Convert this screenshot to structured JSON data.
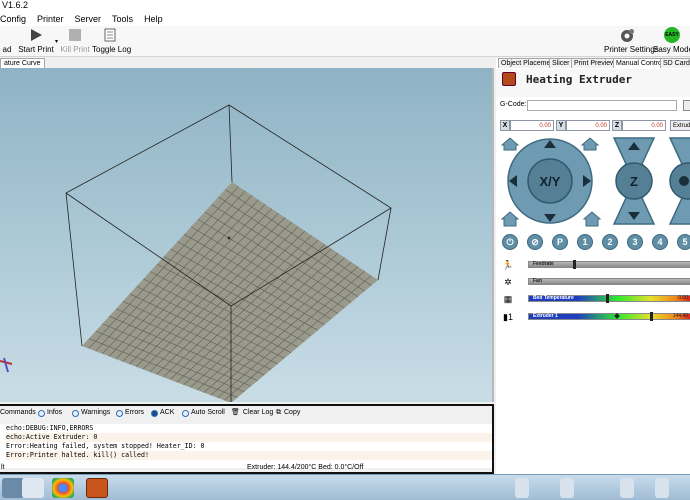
{
  "window": {
    "title": "V1.6.2"
  },
  "menu": [
    "Config",
    "Printer",
    "Server",
    "Tools",
    "Help"
  ],
  "toolbar": {
    "load_label": "ad",
    "start_print_label": "Start Print",
    "kill_print_label": "Kill Print",
    "toggle_log_label": "Toggle Log",
    "printer_settings_label": "Printer Settings",
    "easy_mode_label": "Easy Mode",
    "easy_badge": "EASY"
  },
  "view_tabs": [
    "ature Curve"
  ],
  "right_tabs": [
    "Object Placement",
    "Slicer",
    "Print Preview",
    "Manual Control",
    "SD Card"
  ],
  "right_active_tab": "Manual Control",
  "manual_control": {
    "heading": "Heating Extruder",
    "gcode_label": "G-Code:",
    "gcode_value": "",
    "x_label": "X",
    "x_value": "0.00",
    "y_label": "Y",
    "y_value": "0.00",
    "z_label": "Z",
    "z_value": "0.00",
    "extruder_button": "Extrude",
    "xy_label": "X/Y",
    "z_pad_label": "Z",
    "number_buttons": [
      "P",
      "1",
      "2",
      "3",
      "4",
      "5"
    ],
    "feedrate_label": "Feedrate",
    "fan_label": "Fan",
    "bed_temp_label": "Bed Temperature",
    "bed_temp_value": "0.00",
    "extruder_label": "Extruder 1",
    "extruder_value": "144.40",
    "extruder_index": "1"
  },
  "log": {
    "filters": [
      "Commands",
      "Infos",
      "Warnings",
      "Errors",
      "ACK",
      "Auto Scroll"
    ],
    "clear_label": "Clear Log",
    "copy_label": "Copy",
    "lines": [
      "echo:DEBUG:INFO,ERRORS",
      "echo:Active Extruder: 0",
      "Error:Heating failed, system stopped! Heater_ID: 0",
      "Error:Printer halted. kill() called!"
    ]
  },
  "status": {
    "left": "lt",
    "temps": "Extruder: 144.4/200°C Bed: 0.0°C/Off",
    "state": "Idle"
  },
  "colors": {
    "viewport_top": "#8fb3c4",
    "pad": "#5f8ea5",
    "error": "#c0392b"
  }
}
